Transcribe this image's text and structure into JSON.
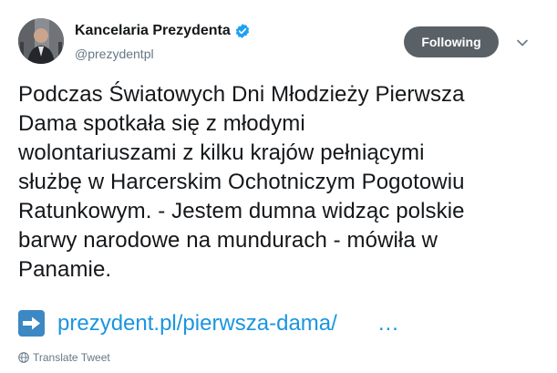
{
  "author": {
    "name": "Kancelaria Prezydenta",
    "handle": "@prezydentpl",
    "verified": true
  },
  "follow_button": {
    "label": "Following",
    "color": "#5a6166"
  },
  "tweet": {
    "text": "Podczas Światowych Dni Młodzieży Pierwsza\nDama spotkała się z młodymi\nwolontariuszami z kilku krajów pełniącymi\nsłużbę w Harcerskim Ochotniczym Pogotowiu\nRatunkowym. - Jestem dumna widząc polskie\nbarwy narodowe na mundurach - mówiła w\nPanamie.",
    "link_text": "prezydent.pl/pierwsza-dama/",
    "link_ellipsis": "…",
    "link_icon": "right-arrow-emoji-icon"
  },
  "footer": {
    "translate_label": "Translate Tweet",
    "translate_icon": "globe-icon"
  },
  "colors": {
    "link": "#1b95e0",
    "verified": "#1da1f2",
    "secondary_text": "#657786"
  }
}
